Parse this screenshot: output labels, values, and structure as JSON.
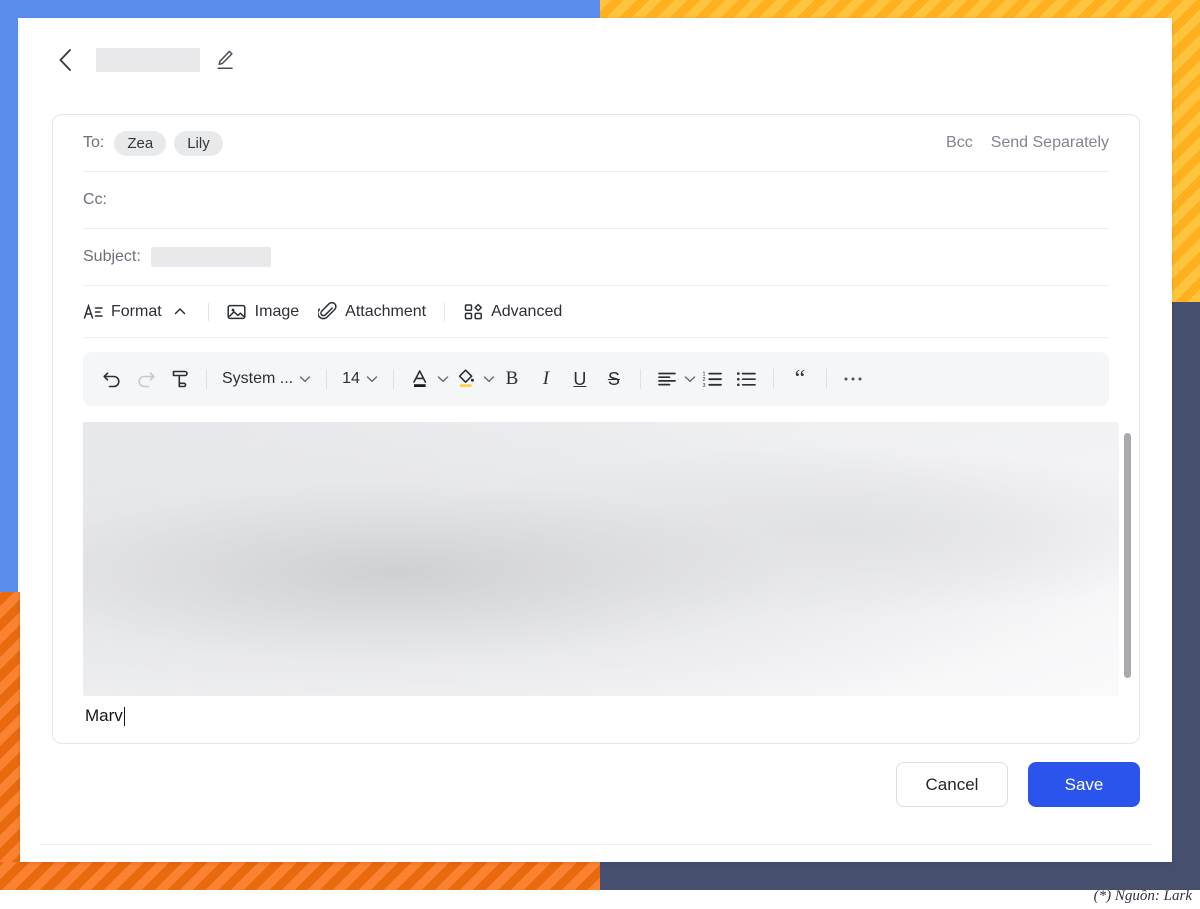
{
  "window": {
    "back_icon": "chevron-left-icon",
    "title_redacted": "",
    "edit_icon": "pencil-edit-icon"
  },
  "compose": {
    "to": {
      "label": "To:",
      "chips": [
        "Zea",
        "Lily"
      ],
      "actions": [
        "Bcc",
        "Send Separately"
      ]
    },
    "cc": {
      "label": "Cc:",
      "value": ""
    },
    "subject": {
      "label": "Subject:",
      "value": ""
    },
    "format_bar": [
      {
        "label": "Format",
        "icon": "format-text-icon",
        "caret": "chevron-up-icon"
      },
      {
        "label": "Image",
        "icon": "image-icon"
      },
      {
        "label": "Attachment",
        "icon": "paperclip-icon"
      },
      {
        "label": "Advanced",
        "icon": "grid-blocks-icon"
      }
    ],
    "toolbar": {
      "undo": "undo-arrow-icon",
      "redo": "redo-arrow-icon",
      "format_painter": "format-painter-icon",
      "font_family": "System ...",
      "font_size": "14",
      "text_color": "text-color-A-icon",
      "text_color_swatch": "#1a1a1a",
      "highlight": "highlight-paint-bucket-icon",
      "highlight_swatch": "#ffd24d",
      "bold": "B",
      "italic": "I",
      "underline": "U",
      "strikethrough": "S",
      "align": "align-left-icon",
      "ordered_list": "numbered-list-icon",
      "bullet_list": "bullet-list-icon",
      "quote": "blockquote-icon",
      "more": "more-horizontal-icon"
    },
    "body": {
      "content_redacted": "",
      "signature": "Marv"
    }
  },
  "footer": {
    "cancel_label": "Cancel",
    "save_label": "Save"
  },
  "source_note": "(*) Nguồn: Lark",
  "colors": {
    "accent_blue": "#2a54eb",
    "deco_blue": "#5b8def",
    "deco_yellow": "#ffc43d",
    "deco_orange": "#fa8231",
    "deco_navy": "#464f6e"
  }
}
